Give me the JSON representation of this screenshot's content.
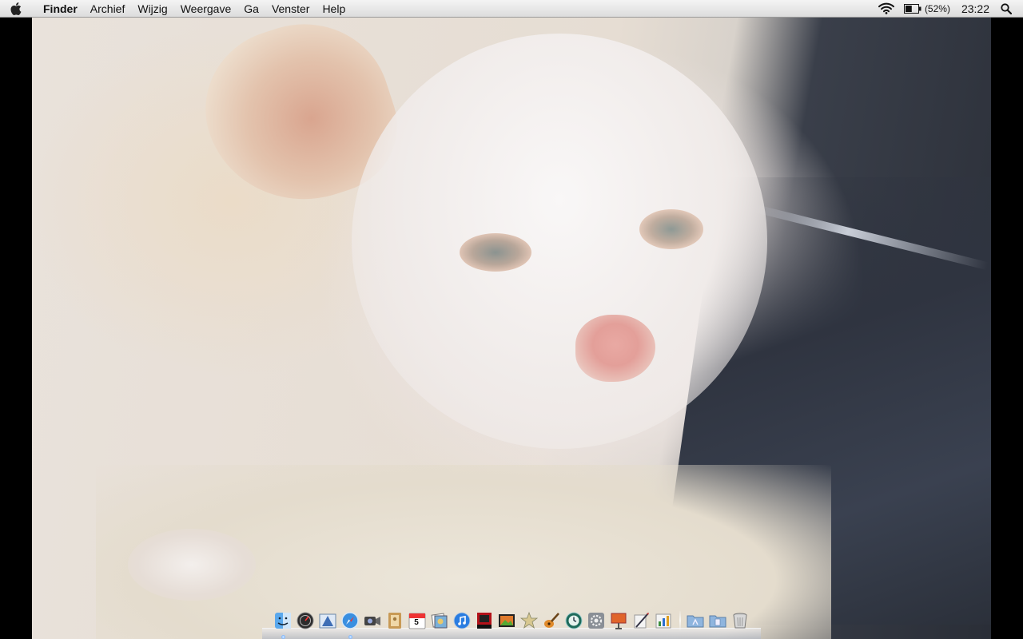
{
  "menubar": {
    "app_name": "Finder",
    "items": [
      {
        "label": "Archief"
      },
      {
        "label": "Wijzig"
      },
      {
        "label": "Weergave"
      },
      {
        "label": "Ga"
      },
      {
        "label": "Venster"
      },
      {
        "label": "Help"
      }
    ],
    "status": {
      "wifi_icon": "wifi-icon",
      "battery_icon": "battery-icon",
      "battery_label": "(52%)",
      "battery_level": 0.52,
      "clock": "23:22",
      "spotlight_icon": "spotlight-search-icon"
    }
  },
  "dock": {
    "apps": [
      {
        "icon": "finder-icon",
        "running": true
      },
      {
        "icon": "dashboard-icon",
        "running": false
      },
      {
        "icon": "mail-icon",
        "running": false
      },
      {
        "icon": "safari-icon",
        "running": true
      },
      {
        "icon": "ichat-icon",
        "running": false
      },
      {
        "icon": "address-book-icon",
        "running": false
      },
      {
        "icon": "ical-icon",
        "running": false,
        "badge_text": "5"
      },
      {
        "icon": "preview-icon",
        "running": false
      },
      {
        "icon": "itunes-icon",
        "running": false
      },
      {
        "icon": "photo-booth-icon",
        "running": false
      },
      {
        "icon": "iphoto-icon",
        "running": false
      },
      {
        "icon": "imovie-icon",
        "running": false
      },
      {
        "icon": "garageband-icon",
        "running": false
      },
      {
        "icon": "time-machine-icon",
        "running": false
      },
      {
        "icon": "system-preferences-icon",
        "running": false
      },
      {
        "icon": "keynote-icon",
        "running": false
      },
      {
        "icon": "pages-icon",
        "running": false
      },
      {
        "icon": "numbers-icon",
        "running": false
      }
    ],
    "stacks": [
      {
        "icon": "applications-folder-icon"
      },
      {
        "icon": "documents-folder-icon"
      },
      {
        "icon": "trash-icon"
      }
    ]
  }
}
